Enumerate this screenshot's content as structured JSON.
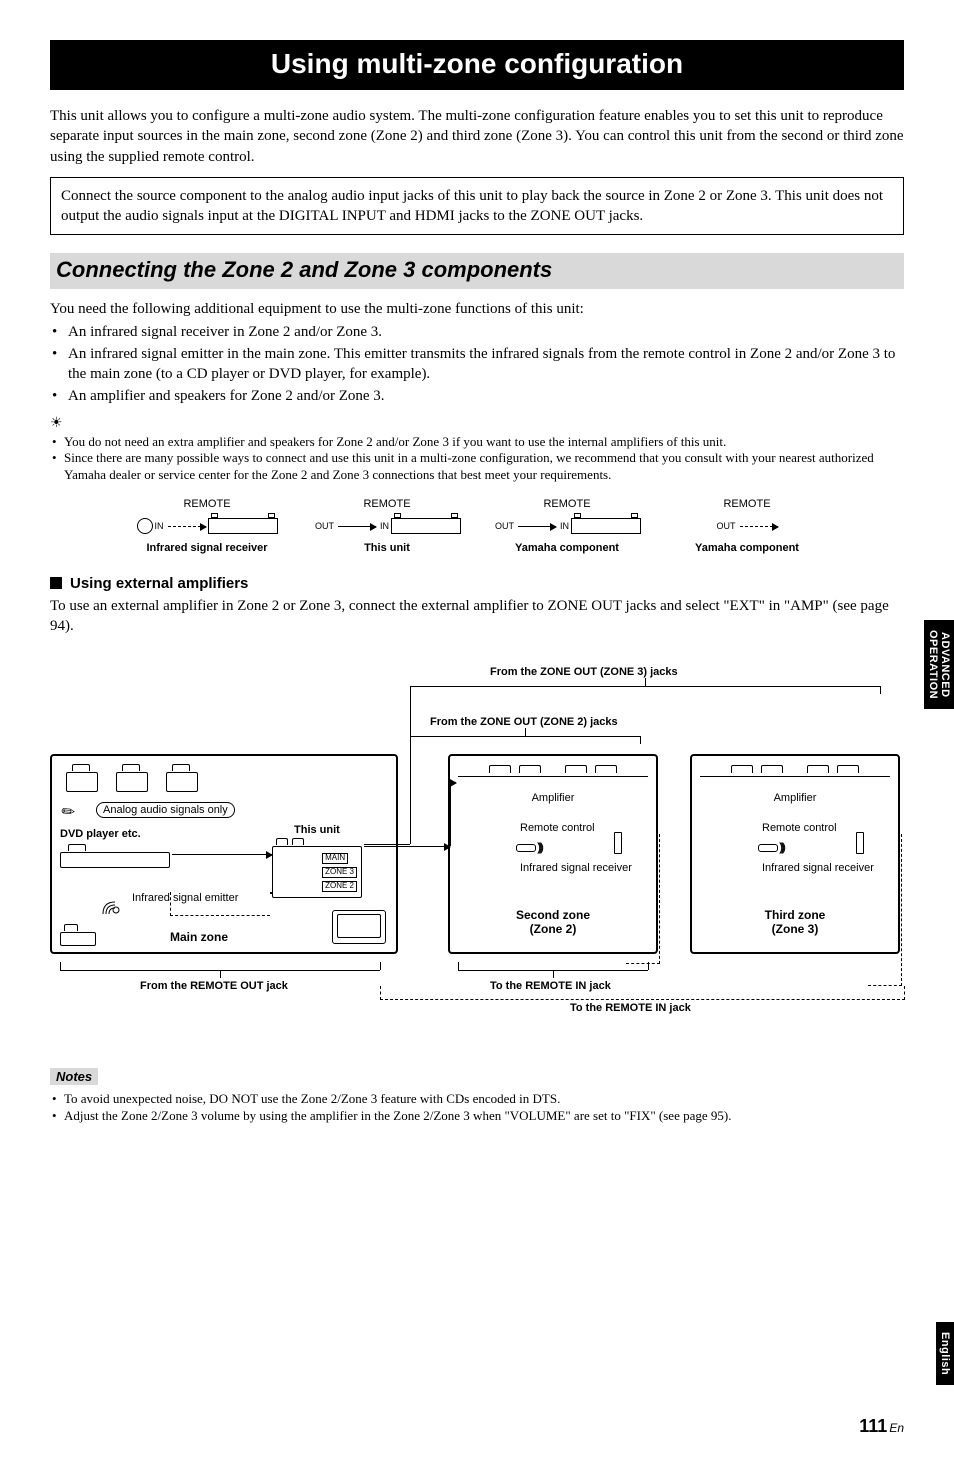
{
  "title": "Using multi-zone configuration",
  "intro": "This unit allows you to configure a multi-zone audio system. The multi-zone configuration feature enables you to set this unit to reproduce separate input sources in the main zone, second zone (Zone 2) and third zone (Zone 3). You can control this unit from the second or third zone using the supplied remote control.",
  "boxed_note": "Connect the source component to the analog audio input jacks of this unit to play back the source in Zone 2 or Zone 3. This unit does not output the audio signals input at the DIGITAL INPUT and HDMI jacks to the ZONE OUT jacks.",
  "section_heading": "Connecting the Zone 2 and Zone 3 components",
  "need_text": "You need the following additional equipment to use the multi-zone functions of this unit:",
  "need_bullets": [
    "An infrared signal receiver in Zone 2 and/or Zone 3.",
    "An infrared signal emitter in the main zone. This emitter transmits the infrared signals from the remote control in Zone 2 and/or Zone 3 to the main zone (to a CD player or DVD player, for example).",
    "An amplifier and speakers for Zone 2 and/or Zone 3."
  ],
  "tip_bullets": [
    "You do not need an extra amplifier and speakers for Zone 2 and/or Zone 3 if you want to use the internal amplifiers of this unit.",
    "Since there are many possible ways to connect and use this unit in a multi-zone configuration, we recommend that you consult with your nearest authorized Yamaha dealer or service center for the Zone 2 and Zone 3 connections that best meet your requirements."
  ],
  "remote_diagram": {
    "labels": {
      "remote": "REMOTE",
      "in": "IN",
      "out": "OUT"
    },
    "captions": [
      "Infrared signal receiver",
      "This unit",
      "Yamaha component",
      "Yamaha component"
    ]
  },
  "subsec_heading": "Using external amplifiers",
  "subsec_text": "To use an external amplifier in Zone 2 or Zone 3, connect the external amplifier to ZONE OUT jacks and select \"EXT\" in \"AMP\" (see page 94).",
  "big_diagram": {
    "from_zone3": "From the ZONE OUT (ZONE 3) jacks",
    "from_zone2": "From the ZONE OUT (ZONE 2) jacks",
    "analog_only": "Analog audio signals only",
    "this_unit": "This unit",
    "dvd": "DVD player etc.",
    "amplifier": "Amplifier",
    "remote_control": "Remote control",
    "ir_receiver": "Infrared signal receiver",
    "ir_emitter": "Infrared signal emitter",
    "main_zone": "Main zone",
    "second_zone_line1": "Second zone",
    "second_zone_line2": "(Zone 2)",
    "third_zone_line1": "Third zone",
    "third_zone_line2": "(Zone 3)",
    "from_remote_out": "From the REMOTE OUT jack",
    "to_remote_in": "To the REMOTE IN jack",
    "tags": {
      "main": "MAIN",
      "zone3": "ZONE 3",
      "zone2": "ZONE 2"
    }
  },
  "notes_label": "Notes",
  "notes_bullets": [
    "To avoid unexpected noise, DO NOT use the Zone 2/Zone 3 feature with CDs encoded in DTS.",
    "Adjust the Zone 2/Zone 3 volume by using the amplifier in the Zone 2/Zone 3 when \"VOLUME\" are set to \"FIX\" (see page 95)."
  ],
  "side_tabs": {
    "advanced_l1": "ADVANCED",
    "advanced_l2": "OPERATION",
    "english": "English"
  },
  "page_number": "111",
  "page_lang": "En"
}
